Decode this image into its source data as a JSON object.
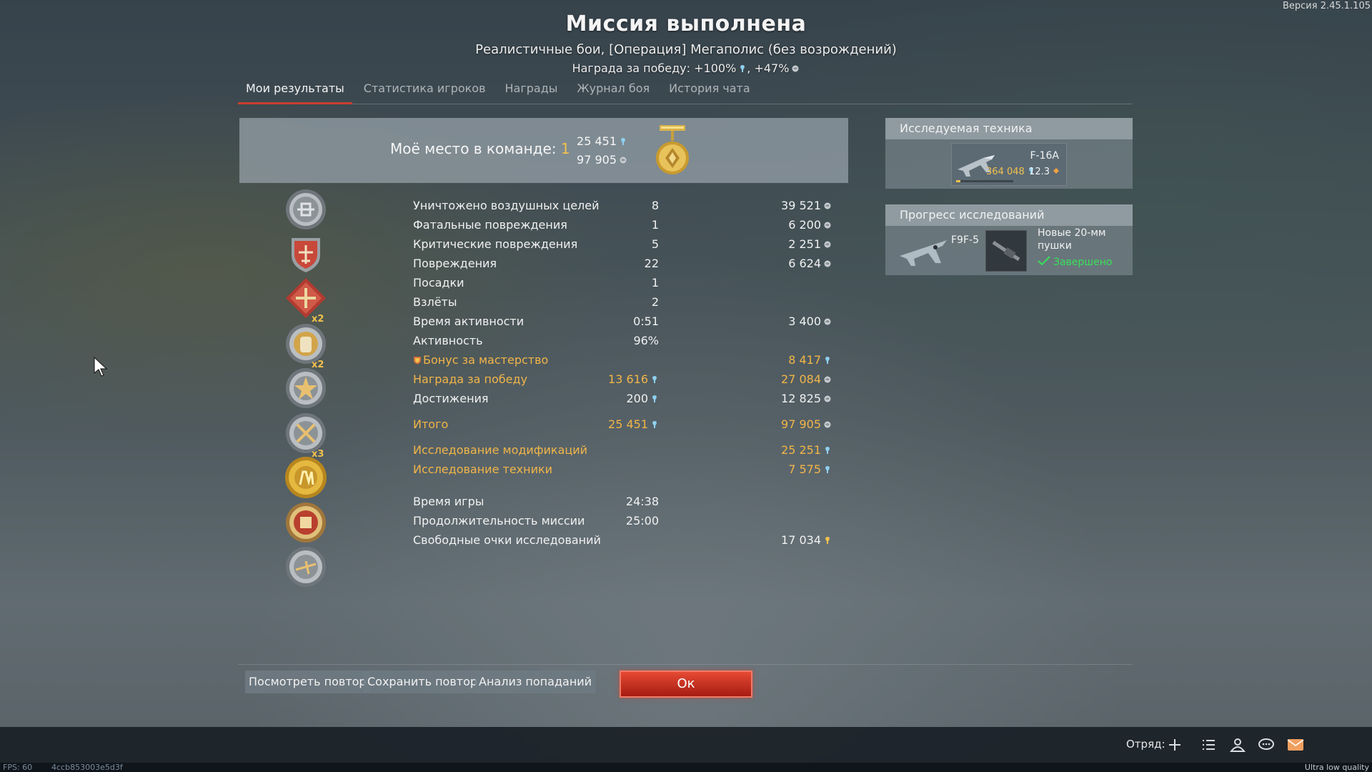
{
  "version": "Версия 2.45.1.105",
  "header": {
    "title": "Миссия выполнена",
    "subtitle": "Реалистичные бои, [Операция] Мегаполис (без возрождений)",
    "reward": "Награда за победу: +100%",
    "reward2": ", +47%"
  },
  "tabs": [
    "Мои результаты",
    "Статистика игроков",
    "Награды",
    "Журнал боя",
    "История чата"
  ],
  "summary": {
    "place_label": "Моё место в команде:",
    "place": "1",
    "rp": "25 451",
    "sl": "97 905"
  },
  "award_multipliers": [
    "x2",
    "x2",
    "x3"
  ],
  "stats": [
    {
      "label": "Уничтожено воздушных целей",
      "count": "8",
      "reward": "39 521",
      "icon": "sl"
    },
    {
      "label": "Фатальные повреждения",
      "count": "1",
      "reward": "6 200",
      "icon": "sl"
    },
    {
      "label": "Критические повреждения",
      "count": "5",
      "reward": "2 251",
      "icon": "sl"
    },
    {
      "label": "Повреждения",
      "count": "22",
      "reward": "6 624",
      "icon": "sl"
    },
    {
      "label": "Посадки",
      "count": "1",
      "reward": "",
      "icon": ""
    },
    {
      "label": "Взлёты",
      "count": "2",
      "reward": "",
      "icon": ""
    },
    {
      "label": "Время активности",
      "count": "0:51",
      "reward": "3 400",
      "icon": "sl"
    },
    {
      "label": "Активность",
      "count": "96%",
      "reward": "",
      "icon": ""
    },
    {
      "label": "Бонус за мастерство",
      "count": "",
      "reward": "8 417",
      "icon": "rp"
    },
    {
      "label": "Награда за победу",
      "count": "13 616",
      "reward": "27 084",
      "icon": "sl"
    },
    {
      "label": "Достижения",
      "count": "200",
      "reward": "12 825",
      "icon": "sl"
    },
    {
      "label": "Итого",
      "count": "25 451",
      "reward": "97 905",
      "icon": "sl"
    },
    {
      "label": "Исследование модификаций",
      "count": "",
      "reward": "25 251",
      "icon": "rp"
    },
    {
      "label": "Исследование техники",
      "count": "",
      "reward": "7 575",
      "icon": "rp"
    },
    {
      "label": "Время игры",
      "count": "24:38",
      "reward": "",
      "icon": ""
    },
    {
      "label": "Продолжительность миссии",
      "count": "25:00",
      "reward": "",
      "icon": ""
    },
    {
      "label": "Свободные очки исследований",
      "count": "",
      "reward": "17 034",
      "icon": "frp"
    }
  ],
  "research": {
    "title": "Исследуемая техника",
    "vehicle": "F-16A",
    "rp": "364 048",
    "br": "12.3",
    "progress": 0.08
  },
  "progress_panel": {
    "title": "Прогресс исследований",
    "vehicle": "F9F-5",
    "module": "Новые 20-мм пушки",
    "status": "Завершено"
  },
  "buttons": {
    "watch_replay": "Посмотреть повтор",
    "save_replay": "Сохранить повтор",
    "hit_analysis": "Анализ попаданий",
    "ok": "Ок"
  },
  "bottombar": {
    "squad": "Отряд:"
  },
  "statusbar": {
    "fps": "FPS: 60",
    "hash": "4ccb853003e5d3f",
    "quality": "Ultra low quality"
  },
  "colors": {
    "gold": "#f2b548",
    "accent_red": "#c8402e",
    "complete_green": "#39e05a"
  }
}
